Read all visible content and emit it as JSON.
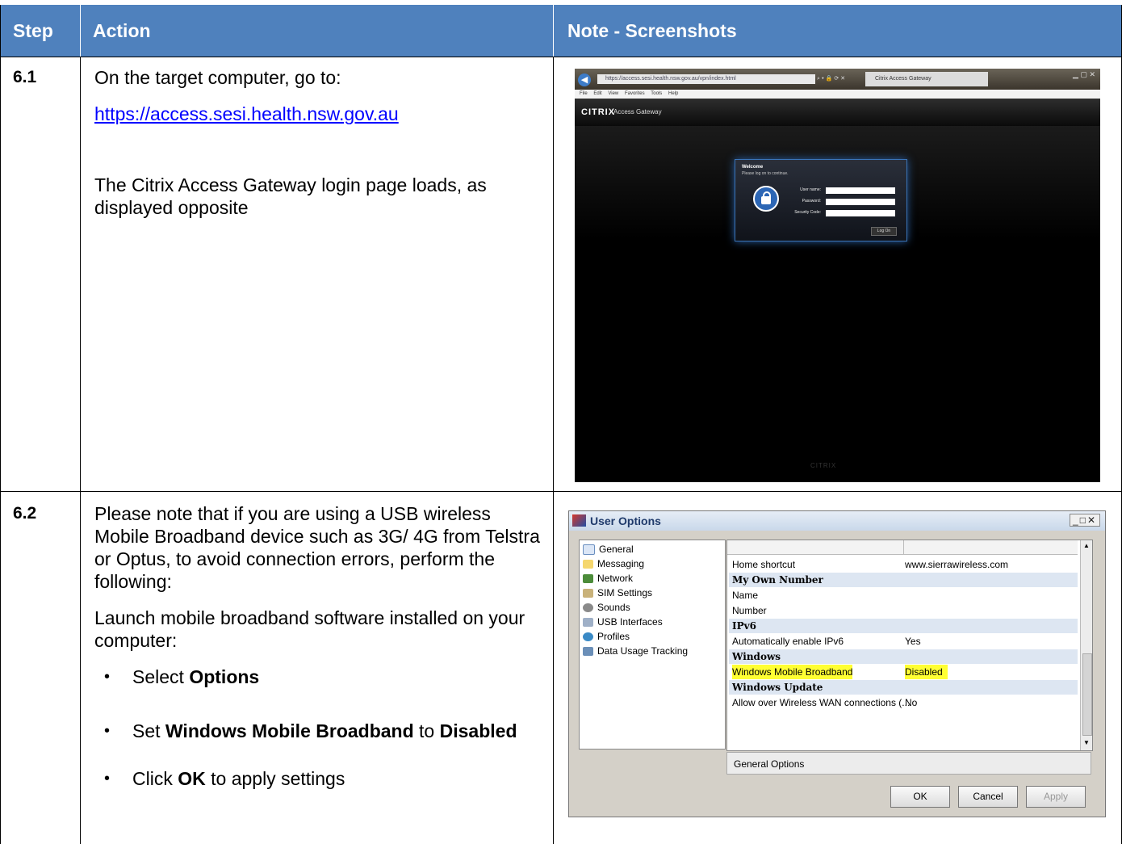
{
  "table": {
    "headers": {
      "step": "Step",
      "action": "Action",
      "note": "Note - Screenshots"
    }
  },
  "rows": [
    {
      "step": "6.1",
      "intro": "On the target computer, go to:",
      "link": "https://access.sesi.health.nsw.gov.au",
      "result": "The Citrix Access Gateway login page loads, as displayed opposite"
    },
    {
      "step": "6.2",
      "intro": "Please note that if you are using a USB wireless Mobile Broadband device such as 3G/ 4G from Telstra or Optus, to avoid connection errors, perform the following:",
      "launch": "Launch mobile broadband software installed on your computer:",
      "bullets": [
        {
          "pre": "Select ",
          "bold": "Options",
          "mid": "",
          "bold2": "",
          "post": ""
        },
        {
          "pre": "Set ",
          "bold": "Windows Mobile Broadband",
          "mid": " to ",
          "bold2": "Disabled",
          "post": ""
        },
        {
          "pre": "Click ",
          "bold": "OK",
          "mid": "",
          "bold2": "",
          "post": " to apply settings"
        }
      ]
    }
  ],
  "citrix_screenshot": {
    "menu": [
      "File",
      "Edit",
      "View",
      "Favorites",
      "Tools",
      "Help"
    ],
    "address": "https://access.sesi.health.nsw.gov.au/vpn/index.html",
    "tab_title": "Citrix Access Gateway",
    "logo": "CITRIX",
    "product": "Access Gateway",
    "welcome": "Welcome",
    "subtitle": "Please log on to continue.",
    "fields": [
      "User name:",
      "Password:",
      "Security Code:"
    ],
    "logon_button": "Log On",
    "footer": "CITRIX"
  },
  "user_options": {
    "title": "User Options",
    "tree": [
      "General",
      "Messaging",
      "Network",
      "SIM Settings",
      "Sounds",
      "USB Interfaces",
      "Profiles",
      "Data Usage Tracking"
    ],
    "rows": [
      {
        "key": "Home shortcut",
        "value": "www.sierrawireless.com",
        "section": false,
        "highlight": false
      },
      {
        "key": "My Own Number",
        "value": "",
        "section": true,
        "highlight": false
      },
      {
        "key": "Name",
        "value": "",
        "section": false,
        "highlight": false
      },
      {
        "key": "Number",
        "value": "",
        "section": false,
        "highlight": false
      },
      {
        "key": "IPv6",
        "value": "",
        "section": true,
        "highlight": false
      },
      {
        "key": "Automatically enable IPv6",
        "value": "Yes",
        "section": false,
        "highlight": false
      },
      {
        "key": "Windows",
        "value": "",
        "section": true,
        "highlight": false
      },
      {
        "key": "Windows Mobile Broadband",
        "value": "Disabled",
        "section": false,
        "highlight": true
      },
      {
        "key": "Windows Update",
        "value": "",
        "section": true,
        "highlight": false
      },
      {
        "key": "Allow over Wireless WAN connections (...",
        "value": "No",
        "section": false,
        "highlight": false
      }
    ],
    "group_label": "General Options",
    "buttons": {
      "ok": "OK",
      "cancel": "Cancel",
      "apply": "Apply"
    }
  }
}
